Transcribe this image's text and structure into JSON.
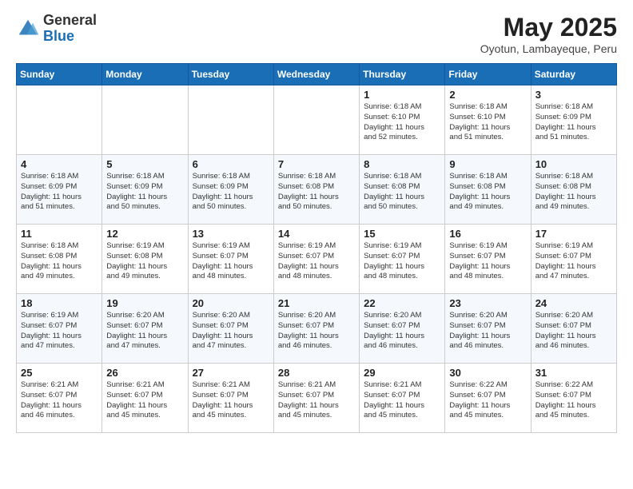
{
  "header": {
    "logo_line1": "General",
    "logo_line2": "Blue",
    "month": "May 2025",
    "location": "Oyotun, Lambayeque, Peru"
  },
  "weekdays": [
    "Sunday",
    "Monday",
    "Tuesday",
    "Wednesday",
    "Thursday",
    "Friday",
    "Saturday"
  ],
  "weeks": [
    [
      {
        "day": "",
        "info": ""
      },
      {
        "day": "",
        "info": ""
      },
      {
        "day": "",
        "info": ""
      },
      {
        "day": "",
        "info": ""
      },
      {
        "day": "1",
        "info": "Sunrise: 6:18 AM\nSunset: 6:10 PM\nDaylight: 11 hours\nand 52 minutes."
      },
      {
        "day": "2",
        "info": "Sunrise: 6:18 AM\nSunset: 6:10 PM\nDaylight: 11 hours\nand 51 minutes."
      },
      {
        "day": "3",
        "info": "Sunrise: 6:18 AM\nSunset: 6:09 PM\nDaylight: 11 hours\nand 51 minutes."
      }
    ],
    [
      {
        "day": "4",
        "info": "Sunrise: 6:18 AM\nSunset: 6:09 PM\nDaylight: 11 hours\nand 51 minutes."
      },
      {
        "day": "5",
        "info": "Sunrise: 6:18 AM\nSunset: 6:09 PM\nDaylight: 11 hours\nand 50 minutes."
      },
      {
        "day": "6",
        "info": "Sunrise: 6:18 AM\nSunset: 6:09 PM\nDaylight: 11 hours\nand 50 minutes."
      },
      {
        "day": "7",
        "info": "Sunrise: 6:18 AM\nSunset: 6:08 PM\nDaylight: 11 hours\nand 50 minutes."
      },
      {
        "day": "8",
        "info": "Sunrise: 6:18 AM\nSunset: 6:08 PM\nDaylight: 11 hours\nand 50 minutes."
      },
      {
        "day": "9",
        "info": "Sunrise: 6:18 AM\nSunset: 6:08 PM\nDaylight: 11 hours\nand 49 minutes."
      },
      {
        "day": "10",
        "info": "Sunrise: 6:18 AM\nSunset: 6:08 PM\nDaylight: 11 hours\nand 49 minutes."
      }
    ],
    [
      {
        "day": "11",
        "info": "Sunrise: 6:18 AM\nSunset: 6:08 PM\nDaylight: 11 hours\nand 49 minutes."
      },
      {
        "day": "12",
        "info": "Sunrise: 6:19 AM\nSunset: 6:08 PM\nDaylight: 11 hours\nand 49 minutes."
      },
      {
        "day": "13",
        "info": "Sunrise: 6:19 AM\nSunset: 6:07 PM\nDaylight: 11 hours\nand 48 minutes."
      },
      {
        "day": "14",
        "info": "Sunrise: 6:19 AM\nSunset: 6:07 PM\nDaylight: 11 hours\nand 48 minutes."
      },
      {
        "day": "15",
        "info": "Sunrise: 6:19 AM\nSunset: 6:07 PM\nDaylight: 11 hours\nand 48 minutes."
      },
      {
        "day": "16",
        "info": "Sunrise: 6:19 AM\nSunset: 6:07 PM\nDaylight: 11 hours\nand 48 minutes."
      },
      {
        "day": "17",
        "info": "Sunrise: 6:19 AM\nSunset: 6:07 PM\nDaylight: 11 hours\nand 47 minutes."
      }
    ],
    [
      {
        "day": "18",
        "info": "Sunrise: 6:19 AM\nSunset: 6:07 PM\nDaylight: 11 hours\nand 47 minutes."
      },
      {
        "day": "19",
        "info": "Sunrise: 6:20 AM\nSunset: 6:07 PM\nDaylight: 11 hours\nand 47 minutes."
      },
      {
        "day": "20",
        "info": "Sunrise: 6:20 AM\nSunset: 6:07 PM\nDaylight: 11 hours\nand 47 minutes."
      },
      {
        "day": "21",
        "info": "Sunrise: 6:20 AM\nSunset: 6:07 PM\nDaylight: 11 hours\nand 46 minutes."
      },
      {
        "day": "22",
        "info": "Sunrise: 6:20 AM\nSunset: 6:07 PM\nDaylight: 11 hours\nand 46 minutes."
      },
      {
        "day": "23",
        "info": "Sunrise: 6:20 AM\nSunset: 6:07 PM\nDaylight: 11 hours\nand 46 minutes."
      },
      {
        "day": "24",
        "info": "Sunrise: 6:20 AM\nSunset: 6:07 PM\nDaylight: 11 hours\nand 46 minutes."
      }
    ],
    [
      {
        "day": "25",
        "info": "Sunrise: 6:21 AM\nSunset: 6:07 PM\nDaylight: 11 hours\nand 46 minutes."
      },
      {
        "day": "26",
        "info": "Sunrise: 6:21 AM\nSunset: 6:07 PM\nDaylight: 11 hours\nand 45 minutes."
      },
      {
        "day": "27",
        "info": "Sunrise: 6:21 AM\nSunset: 6:07 PM\nDaylight: 11 hours\nand 45 minutes."
      },
      {
        "day": "28",
        "info": "Sunrise: 6:21 AM\nSunset: 6:07 PM\nDaylight: 11 hours\nand 45 minutes."
      },
      {
        "day": "29",
        "info": "Sunrise: 6:21 AM\nSunset: 6:07 PM\nDaylight: 11 hours\nand 45 minutes."
      },
      {
        "day": "30",
        "info": "Sunrise: 6:22 AM\nSunset: 6:07 PM\nDaylight: 11 hours\nand 45 minutes."
      },
      {
        "day": "31",
        "info": "Sunrise: 6:22 AM\nSunset: 6:07 PM\nDaylight: 11 hours\nand 45 minutes."
      }
    ]
  ]
}
